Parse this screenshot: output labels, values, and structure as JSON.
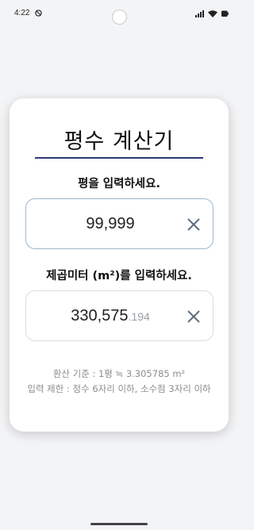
{
  "status_bar": {
    "time": "4:22",
    "icons": [
      "do-not-disturb-icon",
      "signal-icon",
      "wifi-icon",
      "battery-icon"
    ]
  },
  "calculator": {
    "title": "평수 계산기",
    "pyeong_label": "평을 입력하세요.",
    "pyeong_value": "99,999",
    "sqm_label": "제곱미터 (m²)를 입력하세요.",
    "sqm_value_integer": "330,575",
    "sqm_value_decimal": ".194",
    "note_conversion": "환산 기준 : 1평 ≒ 3.305785 m²",
    "note_limit": "입력 제한 : 정수 6자리 이하, 소수점 3자리 이하"
  },
  "colors": {
    "accent": "#2b3a73",
    "focused_border": "#9fb6cc",
    "background": "#f3f4f6"
  }
}
